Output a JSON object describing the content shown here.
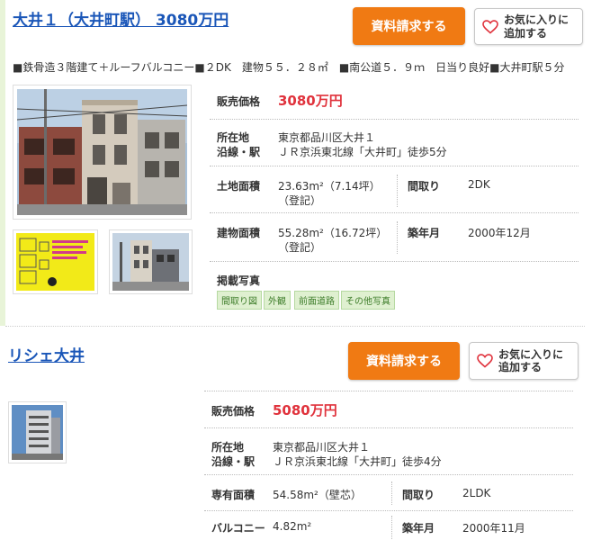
{
  "listings": [
    {
      "title": "大井１（大井町駅） 3080万円",
      "request_button": "資料請求する",
      "favorite_button": [
        "お気に入りに",
        "追加する"
      ],
      "summary": "■鉄骨造３階建て＋ルーフバルコニー■２DK　建物５５．２８㎡　■南公道５．９ｍ　日当り良好■大井町駅５分",
      "price_label": "販売価格",
      "price": "3080万円",
      "location_label": "所在地",
      "location": "東京都品川区大井１",
      "line_label": "沿線・駅",
      "line": "ＪＲ京浜東北線「大井町」徒歩5分",
      "land_area_label": "土地面積",
      "land_area": [
        "23.63m²（7.14坪）",
        "（登記）"
      ],
      "layout_label": "間取り",
      "layout": "2DK",
      "building_area_label": "建物面積",
      "building_area": [
        "55.28m²（16.72坪）",
        "（登記）"
      ],
      "built_label": "築年月",
      "built": "2000年12月",
      "photos_label": "掲載写真",
      "photo_tags": [
        "間取り図",
        "外観",
        "前面道路",
        "その他写真"
      ]
    },
    {
      "title": "リシェ大井",
      "request_button": "資料請求する",
      "favorite_button": [
        "お気に入りに",
        "追加する"
      ],
      "price_label": "販売価格",
      "price": "5080万円",
      "location_label": "所在地",
      "location": "東京都品川区大井１",
      "line_label": "沿線・駅",
      "line": "ＪＲ京浜東北線「大井町」徒歩4分",
      "exclusive_area_label": "専有面積",
      "exclusive_area": "54.58m²（壁芯）",
      "layout_label": "間取り",
      "layout": "2LDK",
      "balcony_label": "バルコニー",
      "balcony": "4.82m²",
      "built_label": "築年月",
      "built": "2000年11月"
    }
  ],
  "colors": {
    "accent_orange": "#f07a13",
    "price_red": "#e0323c",
    "link_blue": "#1a56b8",
    "tag_green": "#dff0d0"
  },
  "icons": [
    "heart-icon"
  ]
}
